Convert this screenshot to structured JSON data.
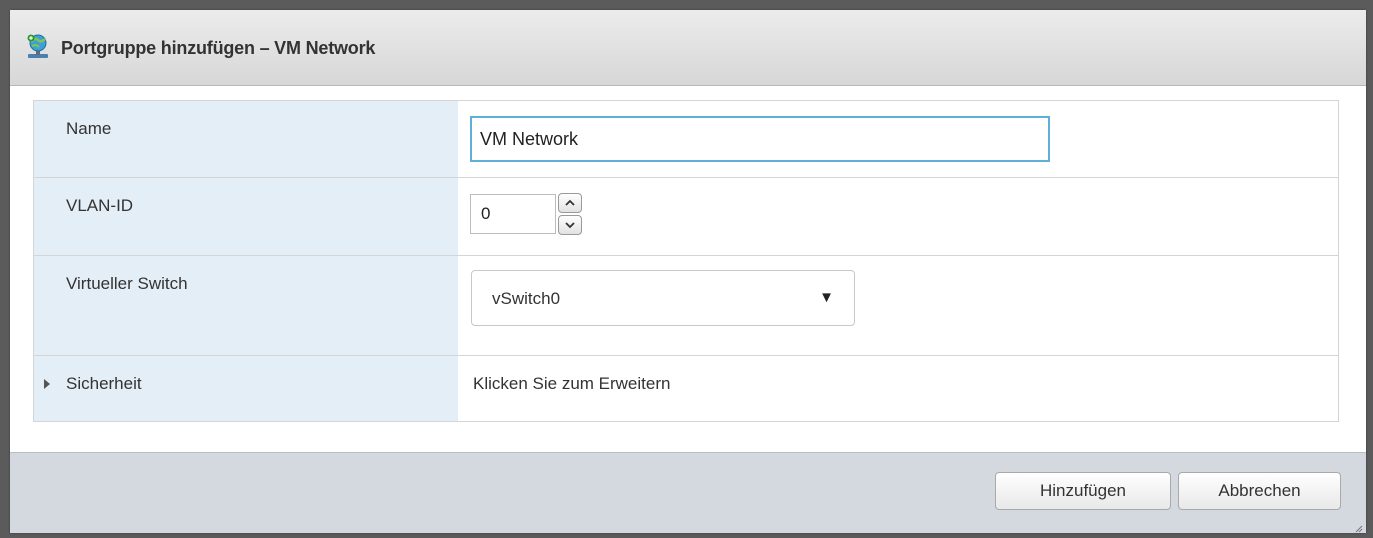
{
  "dialog": {
    "title": "Portgruppe hinzufügen – VM Network",
    "title_icon": "network-portgroup-icon"
  },
  "form": {
    "name": {
      "label": "Name",
      "value": "VM Network"
    },
    "vlan": {
      "label": "VLAN-ID",
      "value": "0"
    },
    "vswitch": {
      "label": "Virtueller Switch",
      "selected": "vSwitch0"
    },
    "security": {
      "label": "Sicherheit",
      "hint": "Klicken Sie zum Erweitern"
    }
  },
  "buttons": {
    "add": "Hinzufügen",
    "cancel": "Abbrechen"
  },
  "colors": {
    "label_background": "#e4eef6",
    "focus_border": "#5fb0d8",
    "footer_background": "#d4d9df"
  }
}
